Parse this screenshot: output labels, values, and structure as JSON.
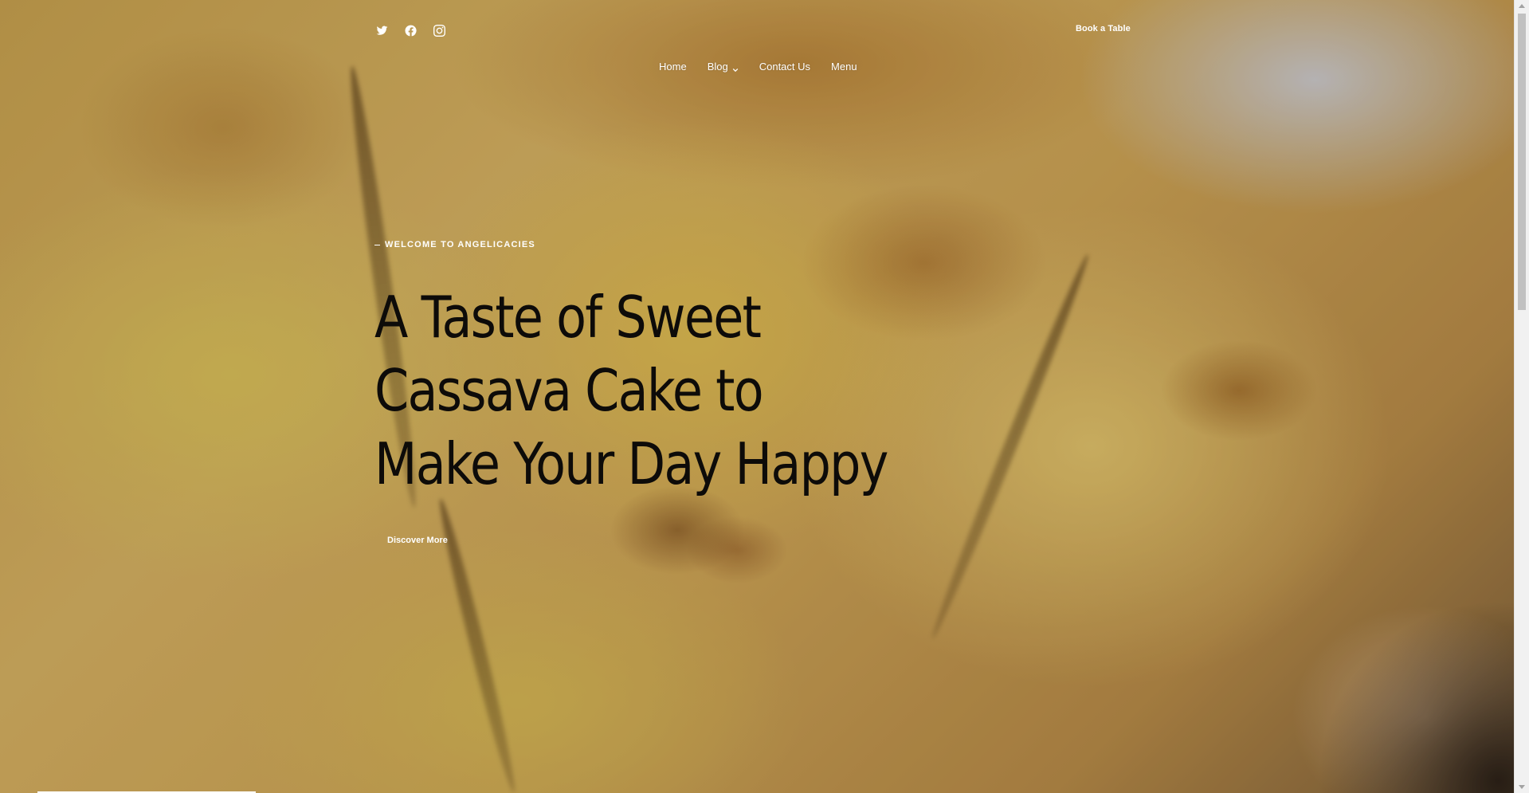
{
  "header": {
    "social": [
      {
        "name": "twitter-icon"
      },
      {
        "name": "facebook-icon"
      },
      {
        "name": "instagram-icon"
      }
    ],
    "cta_label": "Book a Table",
    "nav": [
      {
        "label": "Home"
      },
      {
        "label": "Blog",
        "has_dropdown": true
      },
      {
        "label": "Contact Us"
      },
      {
        "label": "Menu"
      }
    ]
  },
  "hero": {
    "eyebrow": "WELCOME TO ANGELICACIES",
    "headline_lines": [
      "A Taste of Sweet",
      "Cassava Cake to",
      "Make Your Day Happy"
    ],
    "button_label": "Discover More",
    "background": "golden cassava cake photo",
    "slide_progress": 0.12
  },
  "colors": {
    "headline": "#0d0b09",
    "nav_text": "#ffffff",
    "scrollbar_track": "#f1f1f1",
    "scrollbar_thumb": "#c1c1c1"
  }
}
